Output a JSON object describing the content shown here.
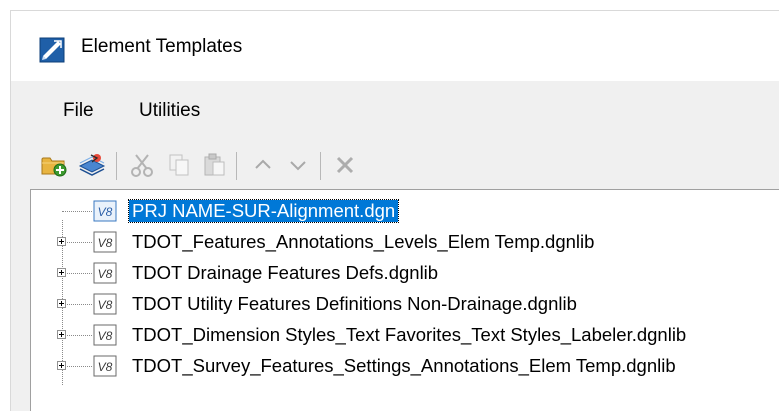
{
  "window": {
    "title": "Element Templates",
    "app_icon": "element-templates-icon"
  },
  "menu": {
    "items": [
      "File",
      "Utilities"
    ]
  },
  "toolbar": {
    "buttons": [
      {
        "name": "open-library-icon"
      },
      {
        "name": "new-template-icon"
      },
      {
        "name": "cut-icon"
      },
      {
        "name": "copy-icon"
      },
      {
        "name": "paste-icon"
      },
      {
        "name": "move-up-icon"
      },
      {
        "name": "move-down-icon"
      },
      {
        "name": "delete-icon"
      }
    ]
  },
  "tree": {
    "items": [
      {
        "label": "PRJ NAME-SUR-Alignment.dgn",
        "badge": "V8",
        "selected": true,
        "expandable": false
      },
      {
        "label": "TDOT_Features_Annotations_Levels_Elem Temp.dgnlib",
        "badge": "V8",
        "selected": false,
        "expandable": true
      },
      {
        "label": "TDOT Drainage Features Defs.dgnlib",
        "badge": "V8",
        "selected": false,
        "expandable": true
      },
      {
        "label": "TDOT Utility Features Definitions Non-Drainage.dgnlib",
        "badge": "V8",
        "selected": false,
        "expandable": true
      },
      {
        "label": "TDOT_Dimension Styles_Text Favorites_Text Styles_Labeler.dgnlib",
        "badge": "V8",
        "selected": false,
        "expandable": true
      },
      {
        "label": "TDOT_Survey_Features_Settings_Annotations_Elem Temp.dgnlib",
        "badge": "V8",
        "selected": false,
        "expandable": true
      }
    ]
  },
  "colors": {
    "selection": "#0078d7",
    "window_bg": "#f0f0f0",
    "tree_bg": "#ffffff"
  }
}
